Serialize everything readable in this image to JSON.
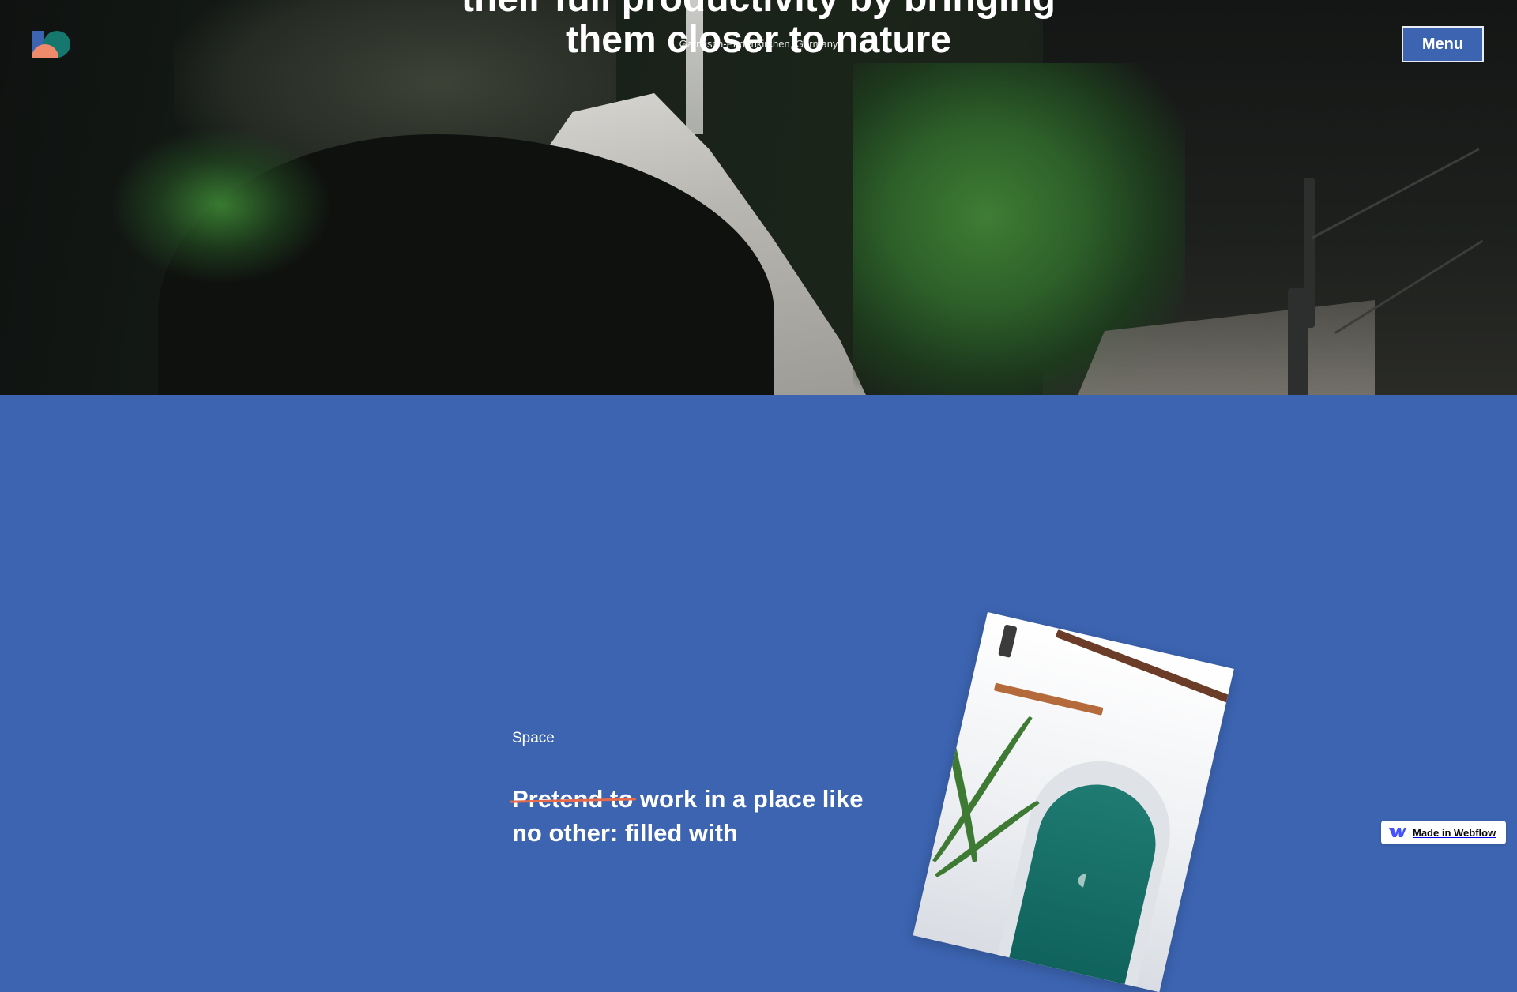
{
  "hero": {
    "title_line1": "their full productivity by bringing",
    "title_line2": "them closer to nature",
    "location": "Garmisch-Partenkirchen, Germany"
  },
  "nav": {
    "logo_icon": "brand-logo-icon",
    "menu_label": "Menu"
  },
  "space": {
    "eyebrow": "Space",
    "headline_struck": "Pretend to",
    "headline_rest": " work in a place like no other: filled with"
  },
  "badge": {
    "label": "Made in Webflow",
    "icon": "webflow-icon"
  },
  "colors": {
    "section_blue": "#3c64b1",
    "strike_accent": "#e56a4c",
    "logo_blue": "#3c64b1",
    "logo_green": "#16776f",
    "logo_coral": "#ef8a6a"
  }
}
